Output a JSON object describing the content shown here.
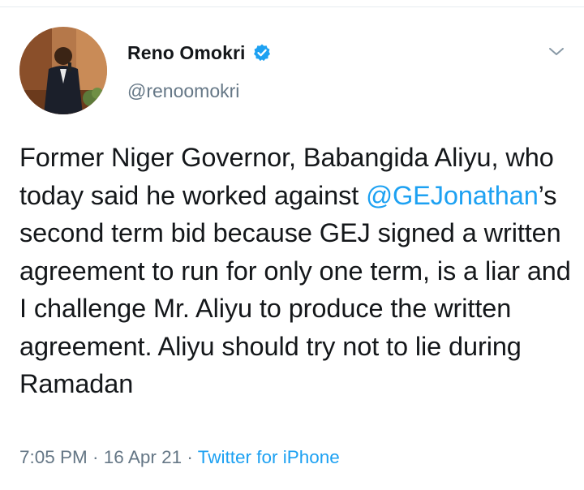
{
  "author": {
    "display_name": "Reno Omokri",
    "handle": "@renoomokri",
    "verified": true
  },
  "tweet": {
    "text_before_mention": "Former Niger Governor, Babangida Aliyu, who today said he worked against ",
    "mention": "@GEJonathan",
    "text_after_mention": "’s second term bid because GEJ signed a written agreement to run for only one term, is a liar and I challenge Mr. Aliyu to produce the written agreement. Aliyu should try not to lie during Ramadan"
  },
  "meta": {
    "time": "7:05 PM",
    "separator_1": " · ",
    "date": "16 Apr 21",
    "separator_2": " · ",
    "source": "Twitter for iPhone"
  },
  "icons": {
    "verified": "verified-badge-icon",
    "more": "chevron-down-icon"
  },
  "colors": {
    "link": "#1da1f2",
    "secondary_text": "#657786",
    "primary_text": "#14171a"
  }
}
